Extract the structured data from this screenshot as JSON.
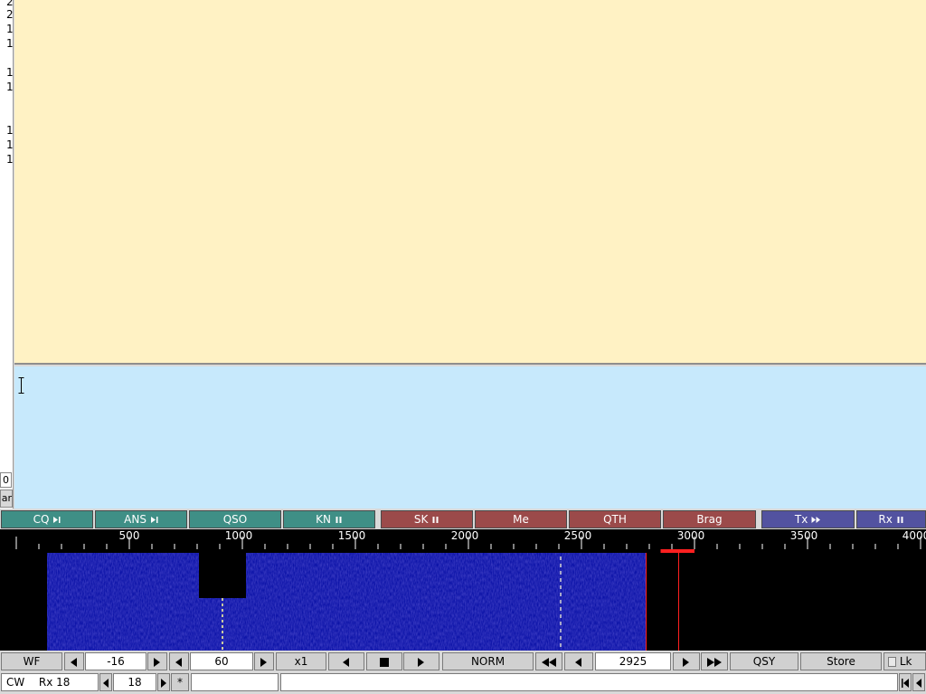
{
  "left_strip": {
    "lines": [
      "2",
      "2",
      "1",
      "1",
      "1",
      "1",
      "1",
      "1",
      "1"
    ]
  },
  "side_boxes": {
    "box_a": "0",
    "box_b": "ar"
  },
  "macros": [
    {
      "label": "CQ",
      "icon": "skip-forward-icon",
      "color": "#3f8f86"
    },
    {
      "label": "ANS",
      "icon": "skip-forward-icon",
      "color": "#3f8f86"
    },
    {
      "label": "QSO",
      "icon": "",
      "color": "#3f8f86"
    },
    {
      "label": "KN",
      "icon": "pause-icon",
      "color": "#3f8f86"
    },
    {
      "label": "SK",
      "icon": "pause-icon",
      "color": "#9b4a4a"
    },
    {
      "label": "Me",
      "icon": "",
      "color": "#9b4a4a"
    },
    {
      "label": "QTH",
      "icon": "",
      "color": "#9b4a4a"
    },
    {
      "label": "Brag",
      "icon": "",
      "color": "#9b4a4a"
    },
    {
      "label": "Tx",
      "icon": "fast-forward-icon",
      "color": "#5252a0"
    },
    {
      "label": "Rx",
      "icon": "pause-icon",
      "color": "#5252a0"
    }
  ],
  "scale": {
    "labels": [
      "500",
      "1000",
      "1500",
      "2000",
      "2500",
      "3000",
      "3500",
      "4000"
    ],
    "cursor_hz": 2925,
    "bandwidth_hz": 150
  },
  "controls": {
    "wf_label": "WF",
    "sig_level": "-16",
    "range": "60",
    "zoom": "x1",
    "norm": "NORM",
    "freq": "2925",
    "qsy": "QSY",
    "store": "Store",
    "lk": "Lk"
  },
  "status": {
    "mode": "CW",
    "rx_label": "Rx 18",
    "rx_value": "18",
    "star": "*"
  },
  "colors": {
    "rx_bg": "#fff2c4",
    "tx_bg": "#c7e9fc",
    "waterfall_signal": "#1a1ad0",
    "cursor": "#ff2020"
  }
}
